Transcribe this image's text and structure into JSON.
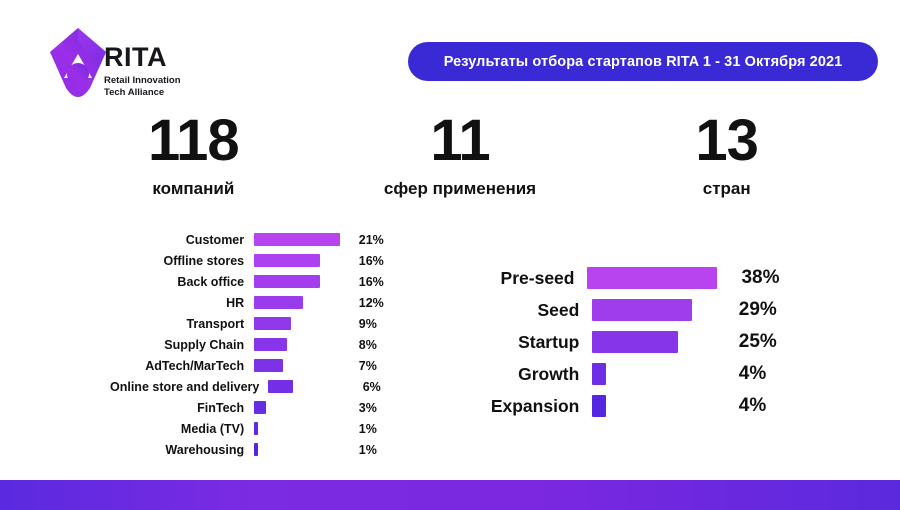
{
  "logo": {
    "wordmark": "RITA",
    "tagline_line1": "Retail Innovation",
    "tagline_line2": "Tech Alliance",
    "mark_icon": "rita-diamond-logo-icon"
  },
  "banner": {
    "title": "Результаты отбора стартапов RITA 1 - 31 Октября 2021",
    "background_color": "#3a2ad6",
    "text_color": "#ffffff"
  },
  "stats": [
    {
      "number": "118",
      "label": "компаний"
    },
    {
      "number": "11",
      "label": "сфер применения"
    },
    {
      "number": "13",
      "label": "стран"
    }
  ],
  "colors": {
    "bar_light": "#b844f0",
    "bar_dark": "#5526e2",
    "banner": "#3a2ad6",
    "text": "#111111",
    "background": "#ffffff"
  },
  "chart_data": [
    {
      "type": "bar",
      "orientation": "horizontal",
      "name": "application-domains",
      "title": "",
      "xlabel": "",
      "ylabel": "",
      "xlim": [
        0,
        21
      ],
      "grid": false,
      "legend": "none",
      "unit": "%",
      "categories": [
        "Customer",
        "Offline stores",
        "Back office",
        "HR",
        "Transport",
        "Supply Chain",
        "AdTech/MarTech",
        "Online store and delivery",
        "FinTech",
        "Media (TV)",
        "Warehousing"
      ],
      "values": [
        21,
        16,
        16,
        12,
        9,
        8,
        7,
        6,
        3,
        1,
        1
      ],
      "value_labels": [
        "21%",
        "16%",
        "16%",
        "12%",
        "9%",
        "8%",
        "7%",
        "6%",
        "3%",
        "1%",
        "1%"
      ]
    },
    {
      "type": "bar",
      "orientation": "horizontal",
      "name": "startup-stages",
      "title": "",
      "xlabel": "",
      "ylabel": "",
      "xlim": [
        0,
        38
      ],
      "grid": false,
      "legend": "none",
      "unit": "%",
      "categories": [
        "Pre-seed",
        "Seed",
        "Startup",
        "Growth",
        "Expansion"
      ],
      "values": [
        38,
        29,
        25,
        4,
        4
      ],
      "value_labels": [
        "38%",
        "29%",
        "25%",
        "4%",
        "4%"
      ]
    }
  ]
}
